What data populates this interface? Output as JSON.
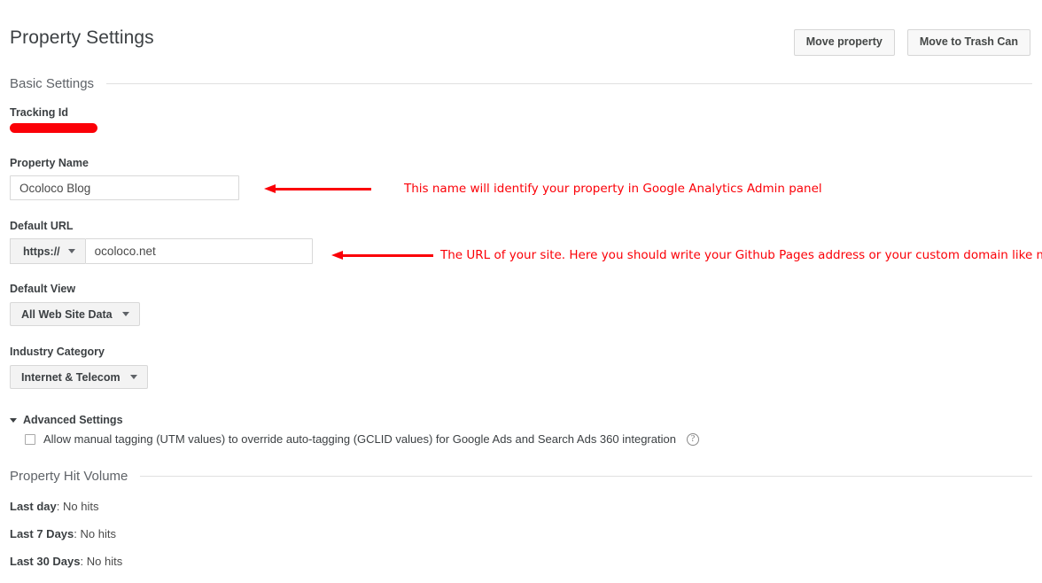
{
  "header": {
    "title": "Property Settings",
    "actions": [
      {
        "label": "Move property",
        "name": "move-property-button"
      },
      {
        "label": "Move to Trash Can",
        "name": "move-to-trash-can-button"
      }
    ]
  },
  "sections": {
    "basic_settings": "Basic Settings",
    "property_hit_volume": "Property Hit Volume"
  },
  "fields": {
    "tracking_id": {
      "label": "Tracking Id",
      "value_redacted": true
    },
    "property_name": {
      "label": "Property Name",
      "value": "Ocoloco Blog",
      "placeholder": ""
    },
    "default_url": {
      "label": "Default URL",
      "scheme": "https://",
      "value": "ocoloco.net",
      "placeholder": ""
    },
    "default_view": {
      "label": "Default View",
      "value": "All Web Site Data"
    },
    "industry_category": {
      "label": "Industry Category",
      "value": "Internet & Telecom"
    }
  },
  "advanced_settings": {
    "label": "Advanced Settings",
    "expanded": true,
    "checkbox": {
      "checked": false,
      "label": "Allow manual tagging (UTM values) to override auto-tagging (GCLID values) for Google Ads and Search Ads 360 integration"
    },
    "help_icon": "?"
  },
  "hit_volume": [
    {
      "label": "Last day",
      "separator": ": ",
      "value": "No hits"
    },
    {
      "label": "Last 7 Days",
      "separator": ": ",
      "value": "No hits"
    },
    {
      "label": "Last 30 Days",
      "separator": ": ",
      "value": "No hits"
    }
  ],
  "annotations": {
    "color": "#fb0007",
    "property_name_note": "This name will identify your property in Google Analytics Admin panel",
    "default_url_note": "The URL of your site. Here you should write your Github Pages address or your custom domain like me."
  }
}
